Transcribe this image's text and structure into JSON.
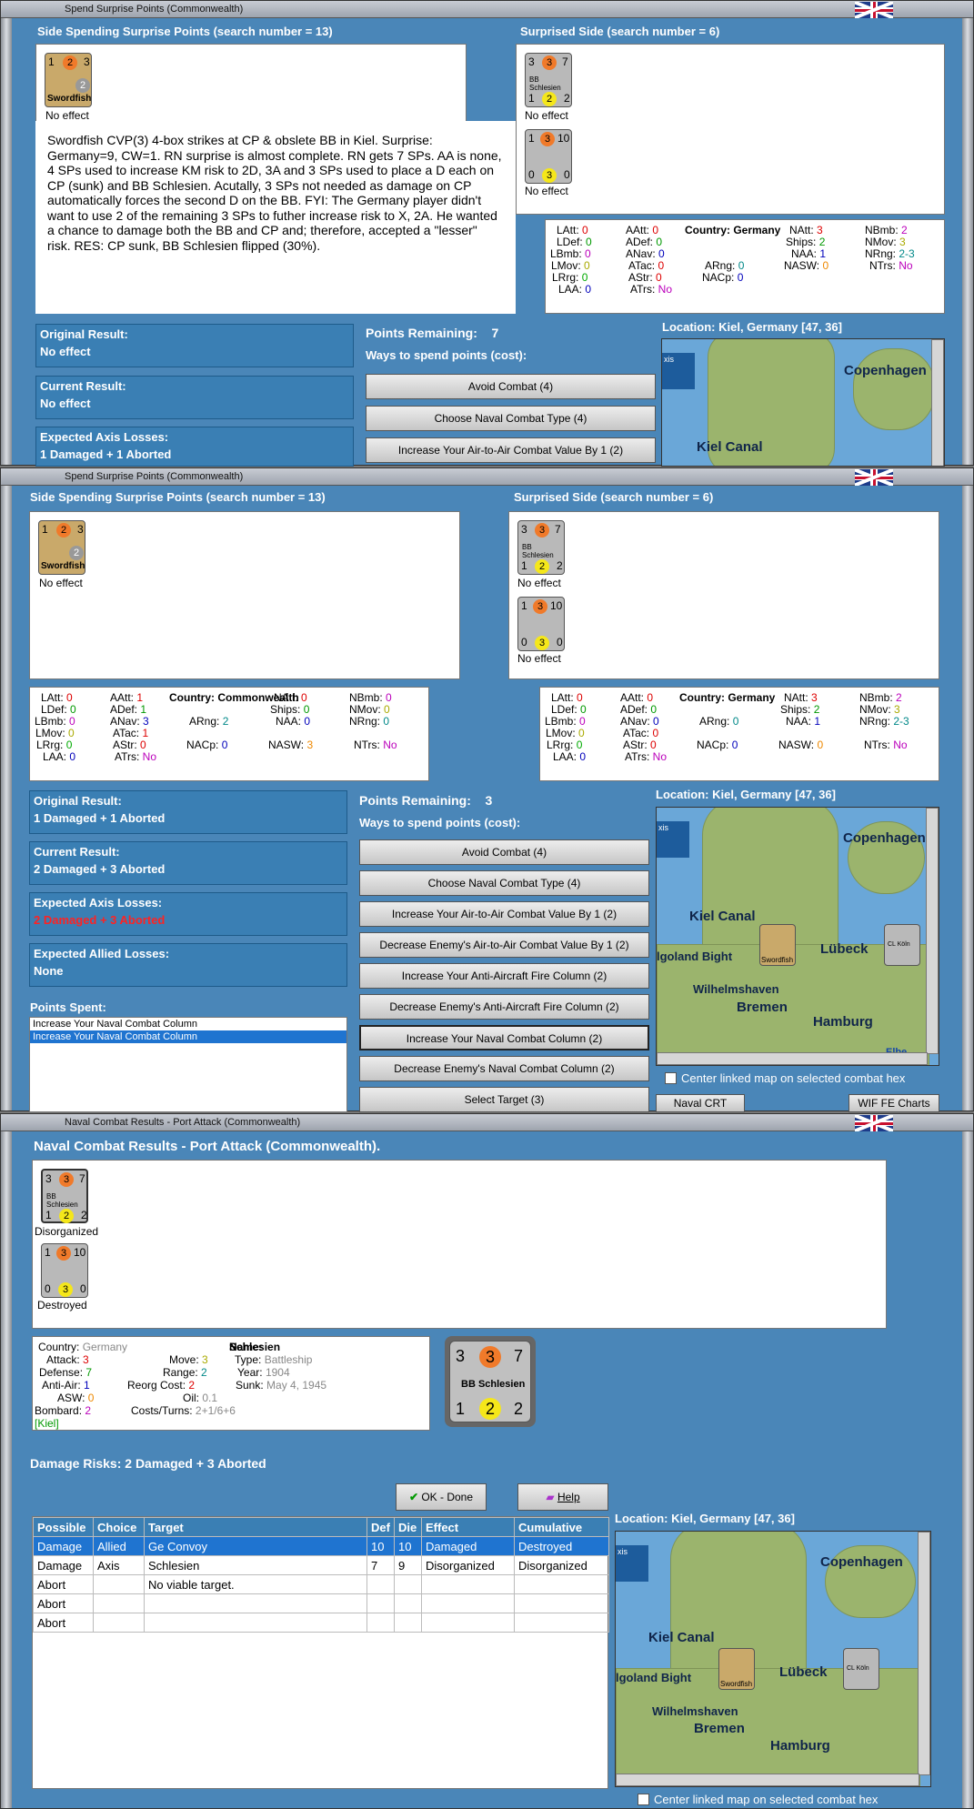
{
  "win1": {
    "title": "Spend Surprise Points (Commonwealth)",
    "side_header": "Side Spending Surprise Points (search number = 13)",
    "surprised_header": "Surprised Side (search number = 6)",
    "note": "Swordfish CVP(3) 4-box strikes at CP & obslete BB in Kiel. Surprise:  Germany=9, CW=1.  RN surprise is almost complete. RN gets 7 SPs.  AA is none, 4 SPs used to increase KM risk to 2D, 3A and 3 SPs used to place a D each on CP (sunk) and BB Schlesien.  Acutally, 3 SPs not needed as damage on CP automatically forces the second D on the BB.  FYI:  The Germany player didn't want to use 2 of the remaining 3 SPs to futher increase risk to X, 2A.  He wanted a chance to damage both the BB and CP and; therefore, accepted a \"lesser\" risk.  RES:  CP sunk, BB Schlesien flipped (30%).",
    "attacker": {
      "name": "Swordfish",
      "a": "1",
      "b": "2",
      "c": "3",
      "d": "2",
      "status": "No effect"
    },
    "defenders": [
      {
        "name": "BB Schlesien",
        "a": "3",
        "b": "3",
        "c": "7",
        "d": "1",
        "e": "2",
        "f": "2",
        "status": "No effect"
      },
      {
        "name": "",
        "a": "1",
        "b": "3",
        "c": "10",
        "d": "0",
        "e": "3",
        "f": "0",
        "status": "No effect"
      }
    ],
    "stats": {
      "country": "Country: Germany",
      "LAtt": "0",
      "AAtt": "0",
      "LDef": "0",
      "ADef": "0",
      "LBmb": "0",
      "ANav": "0",
      "LMov": "0",
      "ATac": "0",
      "LRrg": "0",
      "AStr": "0",
      "LAA": "0",
      "ATrs": "No",
      "ARng": "0",
      "NACp": "0",
      "NAtt": "3",
      "Ships": "2",
      "NAA": "1",
      "NASW": "0",
      "NBmb": "2",
      "NMov": "3",
      "NRng": "2-3",
      "NTrs": "No"
    },
    "original_label": "Original Result:",
    "original": "No effect",
    "current_label": "Current Result:",
    "current": "No effect",
    "expected_label": "Expected Axis Losses:",
    "expected": "1 Damaged + 1 Aborted",
    "points_label": "Points Remaining:",
    "points": "7",
    "ways": "Ways to spend points (cost):",
    "buttons": [
      "Avoid Combat (4)",
      "Choose Naval Combat Type (4)",
      "Increase Your Air-to-Air Combat Value By 1 (2)"
    ],
    "location": "Location: Kiel, Germany [47, 36]"
  },
  "win2": {
    "title": "Spend Surprise Points (Commonwealth)",
    "side_header": "Side Spending Surprise Points (search number = 13)",
    "surprised_header": "Surprised Side (search number = 6)",
    "stats_cw": {
      "country": "Country: Commonwealth",
      "LAtt": "0",
      "AAtt": "1",
      "LDef": "0",
      "ADef": "1",
      "LBmb": "0",
      "ANav": "3",
      "LMov": "0",
      "ATac": "1",
      "LRrg": "0",
      "AStr": "0",
      "LAA": "0",
      "ATrs": "No",
      "ARng": "2",
      "NACp": "0",
      "NAtt": "0",
      "Ships": "0",
      "NAA": "0",
      "NASW": "3",
      "NBmb": "0",
      "NMov": "0",
      "NRng": "0",
      "NTrs": "No"
    },
    "stats_de": {
      "country": "Country: Germany",
      "LAtt": "0",
      "AAtt": "0",
      "LDef": "0",
      "ADef": "0",
      "LBmb": "0",
      "ANav": "0",
      "LMov": "0",
      "ATac": "0",
      "LRrg": "0",
      "AStr": "0",
      "LAA": "0",
      "ATrs": "No",
      "ARng": "0",
      "NACp": "0",
      "NAtt": "3",
      "Ships": "2",
      "NAA": "1",
      "NASW": "0",
      "NBmb": "2",
      "NMov": "3",
      "NRng": "2-3",
      "NTrs": "No"
    },
    "original_label": "Original Result:",
    "original": "1 Damaged + 1 Aborted",
    "current_label": "Current Result:",
    "current": "2 Damaged + 3 Aborted",
    "expected_axis_label": "Expected Axis Losses:",
    "expected_axis": "2 Damaged + 3 Aborted",
    "expected_allied_label": "Expected Allied Losses:",
    "expected_allied": "None",
    "spent_label": "Points Spent:",
    "spent": [
      "Increase Your Naval Combat Column",
      "Increase Your Naval Combat Column"
    ],
    "points_label": "Points Remaining:",
    "points": "3",
    "ways": "Ways to spend points (cost):",
    "buttons": [
      "Avoid Combat (4)",
      "Choose Naval Combat Type (4)",
      "Increase Your Air-to-Air Combat Value By 1 (2)",
      "Decrease Enemy's Air-to-Air Combat Value By 1 (2)",
      "Increase Your Anti-Aircraft Fire Column (2)",
      "Decrease Enemy's Anti-Aircraft Fire Column (2)",
      "Increase Your Naval Combat Column (2)",
      "Decrease Enemy's Naval Combat Column (2)",
      "Select Target (3)"
    ],
    "location": "Location: Kiel, Germany [47, 36]",
    "center_map": "Center linked map on selected combat hex",
    "naval_crt": "Naval CRT",
    "charts": "WIF FE Charts",
    "statuses": [
      "No effect",
      "No effect",
      "No effect"
    ]
  },
  "win3": {
    "title": "Naval Combat Results - Port Attack (Commonwealth)",
    "heading": "Naval Combat Results - Port Attack (Commonwealth).",
    "statuses": [
      "Disorganized",
      "Destroyed"
    ],
    "info": {
      "country_l": "Country:",
      "country": "Germany",
      "attack_l": "Attack:",
      "attack": "3",
      "defense_l": "Defense:",
      "defense": "7",
      "aa_l": "Anti-Air:",
      "aa": "1",
      "asw_l": "ASW:",
      "asw": "0",
      "bombard_l": "Bombard:",
      "bombard": "2",
      "loc": "[Kiel]",
      "move_l": "Move:",
      "move": "3",
      "range_l": "Range:",
      "range": "2",
      "reorg_l": "Reorg Cost:",
      "reorg": "2",
      "oil_l": "Oil:",
      "oil": "0.1",
      "cost_l": "Costs/Turns:",
      "cost": "2+1/6+6",
      "name_l": "Name:",
      "name": "Schlesien",
      "type_l": "Type:",
      "type": "Battleship",
      "year_l": "Year:",
      "year": "1904",
      "sunk_l": "Sunk:",
      "sunk": "May 4, 1945"
    },
    "big_counter": {
      "name": "BB Schlesien",
      "a": "3",
      "b": "3",
      "c": "7",
      "d": "1",
      "e": "2",
      "f": "2"
    },
    "damage_risks": "Damage Risks:  2 Damaged + 3 Aborted",
    "ok": "OK - Done",
    "help": "Help",
    "location": "Location:  Kiel, Germany [47, 36]",
    "center_map": "Center linked map on selected combat hex",
    "table": {
      "headers": [
        "Possible",
        "Choice",
        "Target",
        "Def",
        "Die",
        "Effect",
        "Cumulative"
      ],
      "rows": [
        [
          "Damage",
          "Allied",
          "Ge Convoy",
          "10",
          "10",
          "Damaged",
          "Destroyed"
        ],
        [
          "Damage",
          "Axis",
          "Schlesien",
          "7",
          "9",
          "Disorganized",
          "Disorganized"
        ],
        [
          "Abort",
          "",
          "No viable target.",
          "",
          "",
          "",
          ""
        ],
        [
          "Abort",
          "",
          "",
          "",
          "",
          "",
          ""
        ],
        [
          "Abort",
          "",
          "",
          "",
          "",
          "",
          ""
        ]
      ]
    }
  },
  "map": {
    "copenhagen": "Copenhagen",
    "kiel_canal": "Kiel Canal",
    "lubeck": "Lübeck",
    "helgoland": "lgoland Bight",
    "wilhelmshaven": "Wilhelmshaven",
    "bremen": "Bremen",
    "hamburg": "Hamburg",
    "elbe": "Elbe",
    "cl": "CL Köln",
    "swordfish": "Swordfish",
    "axis": "xis"
  }
}
